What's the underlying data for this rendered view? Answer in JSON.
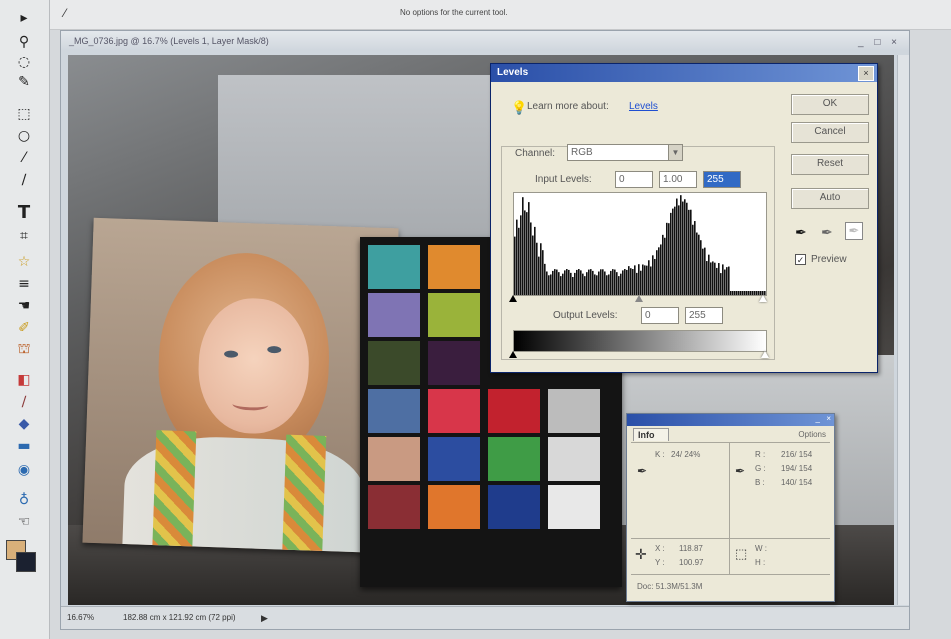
{
  "options_bar": {
    "message": "No options for the current tool."
  },
  "document": {
    "title": "_MG_0736.jpg @ 16.7% (Levels 1, Layer Mask/8)",
    "window_controls": "_ □ ×",
    "status_zoom": "16.67%",
    "status_doc": "182.88 cm x 121.92 cm (72 ppi)"
  },
  "levels": {
    "title": "Levels",
    "learn_more_prefix": "Learn more about:",
    "learn_more_link": "Levels",
    "channel_label": "Channel:",
    "channel_value": "RGB",
    "input_levels_label": "Input Levels:",
    "input_black": "0",
    "input_gamma": "1.00",
    "input_white": "255",
    "output_levels_label": "Output Levels:",
    "output_black": "0",
    "output_white": "255",
    "buttons": {
      "ok": "OK",
      "cancel": "Cancel",
      "reset": "Reset",
      "auto": "Auto"
    },
    "preview_label": "Preview",
    "preview_checked": true
  },
  "info_palette": {
    "tab": "Info",
    "options": "Options",
    "k_left": "K :",
    "k_left_value": "24/ 24%",
    "r_label": "R :",
    "r_value": "216/ 154",
    "g_label": "G :",
    "g_value": "194/ 154",
    "b_label": "B :",
    "b_value": "140/ 154",
    "x_label": "X :",
    "x_value": "118.87",
    "y_label": "Y :",
    "y_value": "100.97",
    "w_label": "W :",
    "h_label": "H :",
    "doc": "Doc: 51.3M/51.3M"
  },
  "colors": {
    "dialog_title": "#2a4fa8",
    "link": "#1f4fd1",
    "highlight": "#316ac5"
  }
}
